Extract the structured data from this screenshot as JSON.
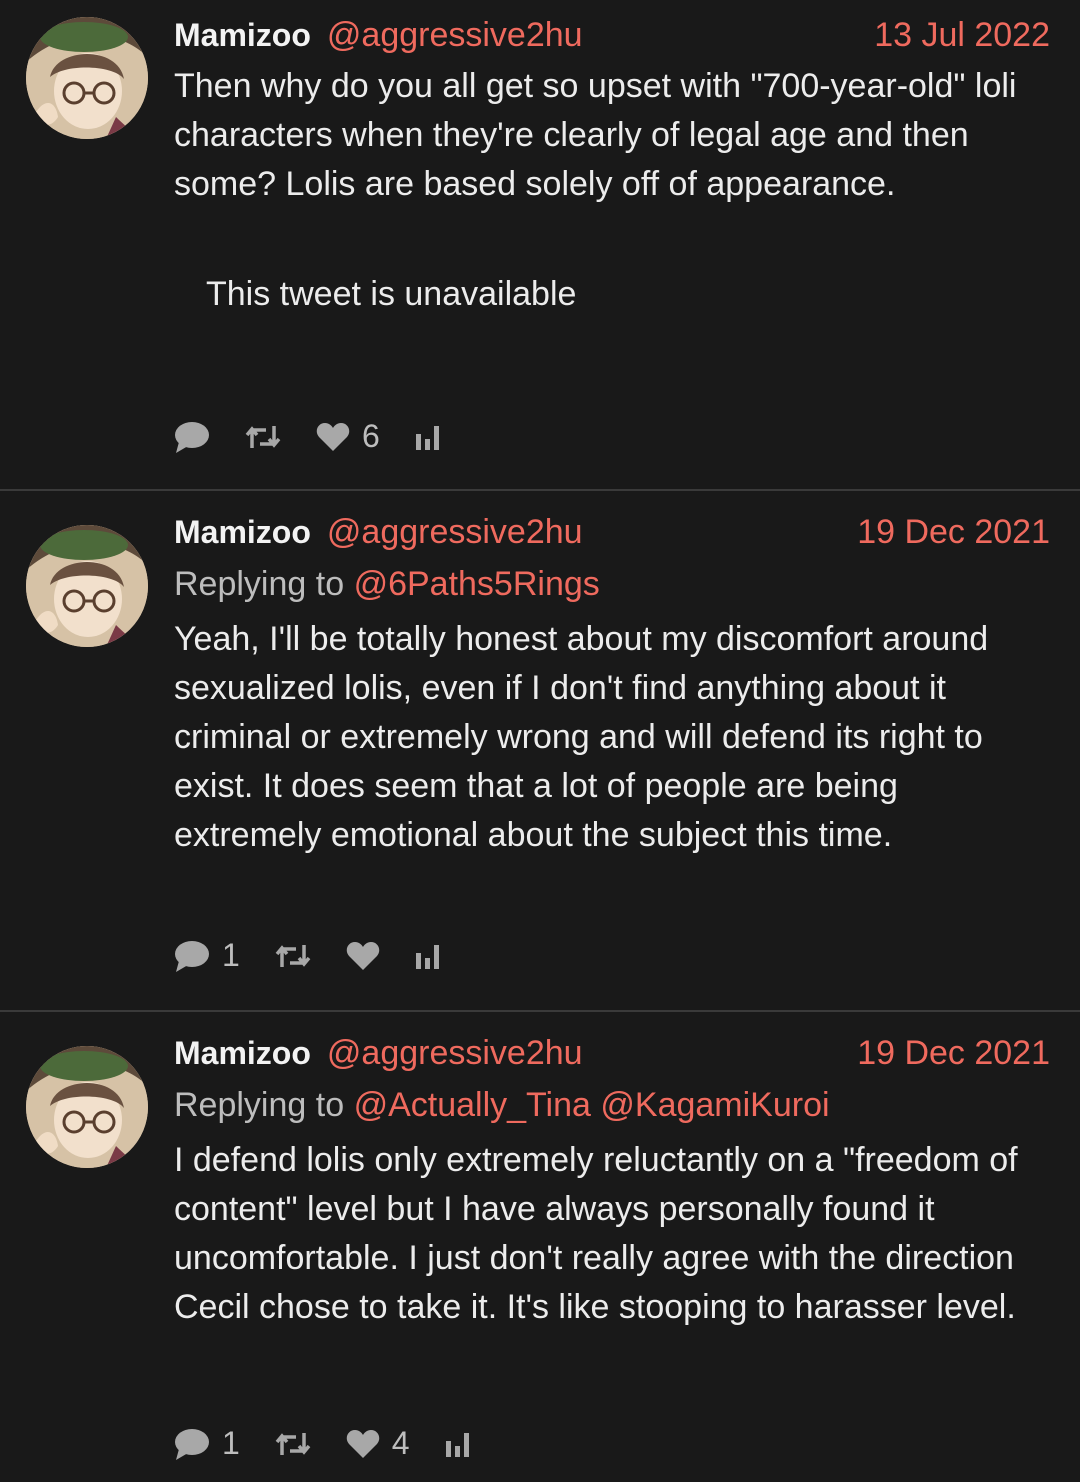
{
  "tweets": [
    {
      "name": "Mamizoo",
      "handle": "@aggressive2hu",
      "date": "13 Jul 2022",
      "reply_prefix": "",
      "reply_handles": [],
      "text": "Then why do you all get so upset with \"700-year-old\" loli characters when they're clearly of legal age and then some?  Lolis are based solely off of appearance.",
      "quote_unavailable": "This tweet is unavailable",
      "stats": {
        "replies": "",
        "retweets": "",
        "likes": "6"
      }
    },
    {
      "name": "Mamizoo",
      "handle": "@aggressive2hu",
      "date": "19 Dec 2021",
      "reply_prefix": "Replying to",
      "reply_handles": [
        "@6Paths5Rings"
      ],
      "text": "Yeah, I'll be totally honest about my discomfort around sexualized lolis, even if I don't find anything about it criminal or extremely wrong and will defend its right to exist. It does seem that a lot of people are being extremely emotional about the subject this time.",
      "stats": {
        "replies": "1",
        "retweets": "",
        "likes": ""
      }
    },
    {
      "name": "Mamizoo",
      "handle": "@aggressive2hu",
      "date": "19 Dec 2021",
      "reply_prefix": "Replying to",
      "reply_handles": [
        "@Actually_Tina",
        "@KagamiKuroi"
      ],
      "text": "I defend lolis only extremely reluctantly on a \"freedom of content\" level but I have always personally found it uncomfortable.  I just don't really agree with the direction Cecil chose to take it.  It's like stooping to harasser level.",
      "stats": {
        "replies": "1",
        "retweets": "",
        "likes": "4"
      }
    }
  ],
  "colors": {
    "background": "#191919",
    "accent": "#ef6a5e",
    "text": "#ececec",
    "muted": "#a8a8a8"
  },
  "icons": [
    "avatar-image",
    "comment-icon",
    "retweet-icon",
    "heart-icon",
    "stats-icon"
  ]
}
